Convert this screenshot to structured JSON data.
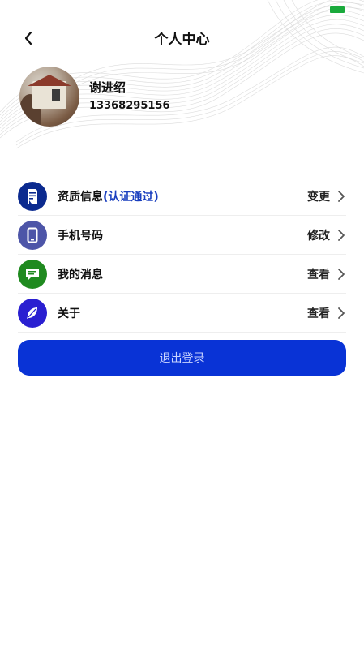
{
  "header": {
    "title": "个人中心",
    "back_icon": "chevron-left-icon"
  },
  "profile": {
    "name": "谢进绍",
    "phone": "13368295156"
  },
  "menu": {
    "items": [
      {
        "label": "资质信息",
        "status": "(认证通过)",
        "action": "变更",
        "icon": "document-icon",
        "color": "#0b2a8f"
      },
      {
        "label": "手机号码",
        "status": "",
        "action": "修改",
        "icon": "tablet-icon",
        "color": "#4d55a8"
      },
      {
        "label": "我的消息",
        "status": "",
        "action": "查看",
        "icon": "message-icon",
        "color": "#1f8a1f"
      },
      {
        "label": "关于",
        "status": "",
        "action": "查看",
        "icon": "feather-icon",
        "color": "#2a1fd1"
      }
    ]
  },
  "logout": {
    "label": "退出登录",
    "color": "#0933d6"
  },
  "status_bar": {
    "battery_color": "#1aaa3c"
  }
}
